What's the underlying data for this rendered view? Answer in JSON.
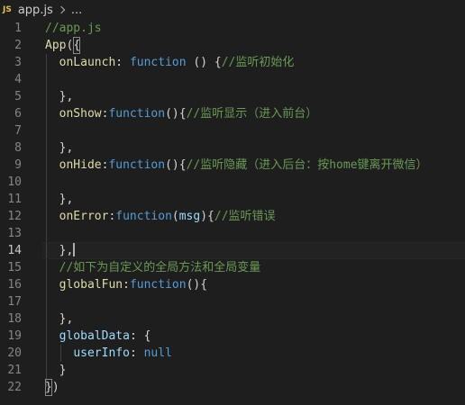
{
  "breadcrumb": {
    "badge": "JS",
    "file": "app.js",
    "more": "..."
  },
  "lines": [
    {
      "n": "1",
      "tokens": [
        {
          "t": "//app.js",
          "c": "cm"
        }
      ]
    },
    {
      "n": "2",
      "tokens": [
        {
          "t": "App",
          "c": "fn"
        },
        {
          "t": "(",
          "c": "pn"
        },
        {
          "t": "{",
          "c": "pn",
          "box": true
        }
      ]
    },
    {
      "n": "3",
      "tokens": [
        {
          "t": "  "
        },
        {
          "t": "onLaunch",
          "c": "fn"
        },
        {
          "t": ": ",
          "c": "pn"
        },
        {
          "t": "function",
          "c": "kw"
        },
        {
          "t": " () {",
          "c": "pn"
        },
        {
          "t": "//监听初始化",
          "c": "cm"
        }
      ]
    },
    {
      "n": "4",
      "tokens": []
    },
    {
      "n": "5",
      "tokens": [
        {
          "t": "  },",
          "c": "pn"
        }
      ]
    },
    {
      "n": "6",
      "tokens": [
        {
          "t": "  "
        },
        {
          "t": "onShow",
          "c": "fn"
        },
        {
          "t": ":",
          "c": "pn"
        },
        {
          "t": "function",
          "c": "kw"
        },
        {
          "t": "(){",
          "c": "pn"
        },
        {
          "t": "//监听显示（进入前台）",
          "c": "cm"
        }
      ]
    },
    {
      "n": "7",
      "tokens": []
    },
    {
      "n": "8",
      "tokens": [
        {
          "t": "  },",
          "c": "pn"
        }
      ]
    },
    {
      "n": "9",
      "tokens": [
        {
          "t": "  "
        },
        {
          "t": "onHide",
          "c": "fn"
        },
        {
          "t": ":",
          "c": "pn"
        },
        {
          "t": "function",
          "c": "kw"
        },
        {
          "t": "(){",
          "c": "pn"
        },
        {
          "t": "//监听隐藏（进入后台：按home键离开微信）",
          "c": "cm"
        }
      ]
    },
    {
      "n": "10",
      "tokens": []
    },
    {
      "n": "11",
      "tokens": [
        {
          "t": "  },",
          "c": "pn"
        }
      ]
    },
    {
      "n": "12",
      "tokens": [
        {
          "t": "  "
        },
        {
          "t": "onError",
          "c": "fn"
        },
        {
          "t": ":",
          "c": "pn"
        },
        {
          "t": "function",
          "c": "kw"
        },
        {
          "t": "(",
          "c": "pn"
        },
        {
          "t": "msg",
          "c": "prop"
        },
        {
          "t": "){",
          "c": "pn"
        },
        {
          "t": "//监听错误",
          "c": "cm"
        }
      ]
    },
    {
      "n": "13",
      "tokens": []
    },
    {
      "n": "14",
      "tokens": [
        {
          "t": "  },",
          "c": "pn"
        }
      ],
      "active": true,
      "cursor": true
    },
    {
      "n": "15",
      "tokens": [
        {
          "t": "  "
        },
        {
          "t": "//如下为自定义的全局方法和全局变量",
          "c": "cm"
        }
      ]
    },
    {
      "n": "16",
      "tokens": [
        {
          "t": "  "
        },
        {
          "t": "globalFun",
          "c": "fn"
        },
        {
          "t": ":",
          "c": "pn"
        },
        {
          "t": "function",
          "c": "kw"
        },
        {
          "t": "(){",
          "c": "pn"
        }
      ]
    },
    {
      "n": "17",
      "tokens": []
    },
    {
      "n": "18",
      "tokens": [
        {
          "t": "  },",
          "c": "pn"
        }
      ]
    },
    {
      "n": "19",
      "tokens": [
        {
          "t": "  "
        },
        {
          "t": "globalData",
          "c": "prop"
        },
        {
          "t": ": {",
          "c": "pn"
        }
      ]
    },
    {
      "n": "20",
      "tokens": [
        {
          "t": "    "
        },
        {
          "t": "userInfo",
          "c": "prop"
        },
        {
          "t": ": ",
          "c": "pn"
        },
        {
          "t": "null",
          "c": "kw"
        }
      ]
    },
    {
      "n": "21",
      "tokens": [
        {
          "t": "  }",
          "c": "pn"
        }
      ]
    },
    {
      "n": "22",
      "tokens": [
        {
          "t": "}",
          "c": "pn",
          "box": true
        },
        {
          "t": ")",
          "c": "pn"
        }
      ]
    }
  ],
  "colors": {
    "background": "#1e1e1e",
    "comment": "#6a9955",
    "keyword": "#569cd6",
    "function": "#dcdcaa",
    "property": "#9cdcfe",
    "text": "#d4d4d4",
    "line_number": "#858585",
    "js_badge": "#e8c04b"
  }
}
